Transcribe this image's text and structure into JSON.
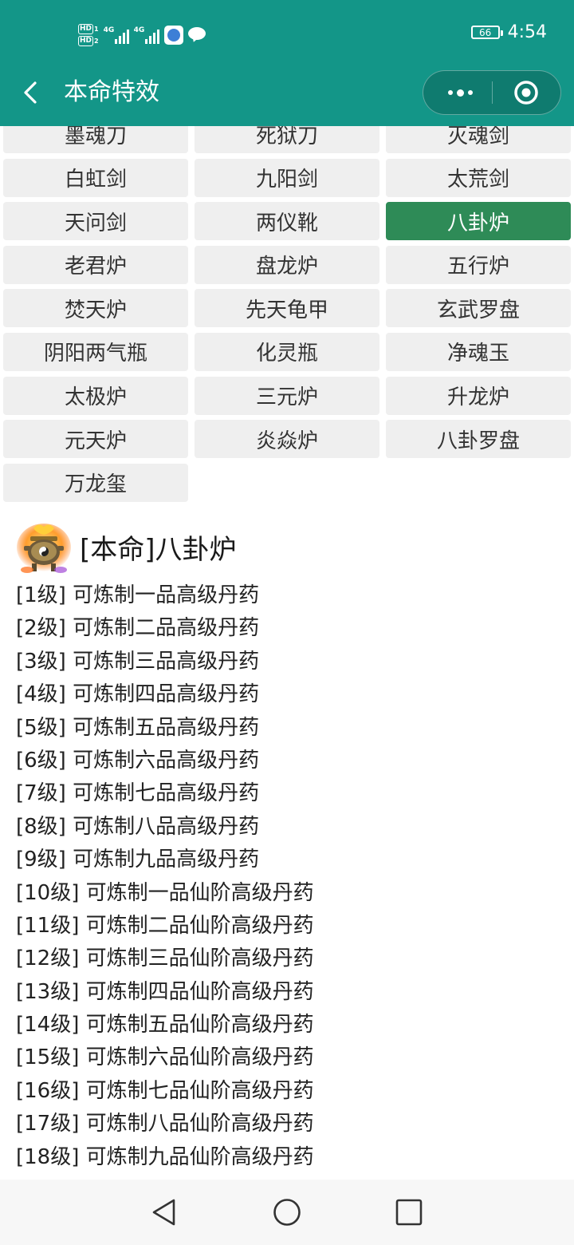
{
  "status_bar": {
    "hd1": "HD",
    "hd1_index": "1",
    "hd2": "HD",
    "hd2_index": "2",
    "signal1_tag": "4G",
    "signal2_tag": "4G",
    "battery": "66",
    "time": "4:54"
  },
  "header": {
    "title": "本命特效",
    "icons": {
      "back": "chevron-left-icon",
      "more": "more-dots-icon",
      "close": "target-icon"
    }
  },
  "items": [
    "墨魂刀",
    "死狱刀",
    "灭魂剑",
    "白虹剑",
    "九阳剑",
    "太荒剑",
    "天问剑",
    "两仪靴",
    "八卦炉",
    "老君炉",
    "盘龙炉",
    "五行炉",
    "焚天炉",
    "先天龟甲",
    "玄武罗盘",
    "阴阳两气瓶",
    "化灵瓶",
    "净魂玉",
    "太极炉",
    "三元炉",
    "升龙炉",
    "元天炉",
    "炎焱炉",
    "八卦罗盘",
    "万龙玺"
  ],
  "selected_item": "八卦炉",
  "detail": {
    "title": "[本命]八卦炉",
    "icon": "furnace-icon",
    "levels": [
      "[1级] 可炼制一品高级丹药",
      "[2级] 可炼制二品高级丹药",
      "[3级] 可炼制三品高级丹药",
      "[4级] 可炼制四品高级丹药",
      "[5级] 可炼制五品高级丹药",
      "[6级] 可炼制六品高级丹药",
      "[7级] 可炼制七品高级丹药",
      "[8级] 可炼制八品高级丹药",
      "[9级] 可炼制九品高级丹药",
      "[10级] 可炼制一品仙阶高级丹药",
      "[11级] 可炼制二品仙阶高级丹药",
      "[12级] 可炼制三品仙阶高级丹药",
      "[13级] 可炼制四品仙阶高级丹药",
      "[14级] 可炼制五品仙阶高级丹药",
      "[15级] 可炼制六品仙阶高级丹药",
      "[16级] 可炼制七品仙阶高级丹药",
      "[17级] 可炼制八品仙阶高级丹药",
      "[18级] 可炼制九品仙阶高级丹药"
    ]
  },
  "colors": {
    "header_bg": "#139688",
    "selected_bg": "#2e8b57",
    "cell_bg": "#efefef"
  },
  "nav_bar": {
    "icons": [
      "triangle-back-icon",
      "circle-home-icon",
      "square-recents-icon"
    ]
  }
}
